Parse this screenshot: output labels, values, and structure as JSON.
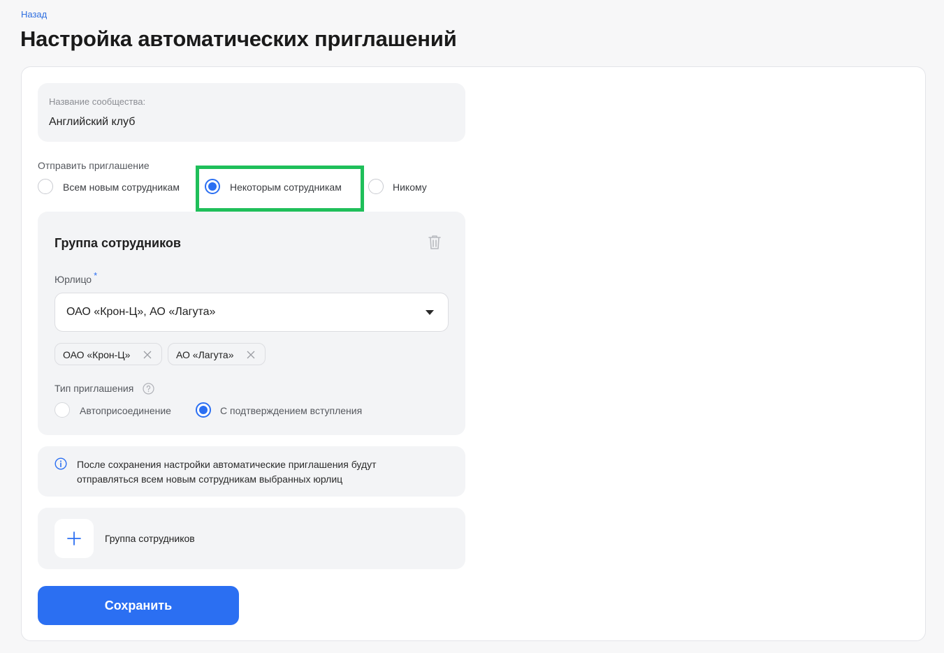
{
  "header": {
    "back_label": "Назад",
    "title": "Настройка автоматических приглашений"
  },
  "community": {
    "label": "Название сообщества:",
    "value": "Английский клуб"
  },
  "send_invite": {
    "label": "Отправить приглашение",
    "options": [
      {
        "label": "Всем новым сотрудникам",
        "checked": false
      },
      {
        "label": "Некоторым сотрудникам",
        "checked": true
      },
      {
        "label": "Никому",
        "checked": false
      }
    ]
  },
  "group": {
    "title": "Группа сотрудников",
    "legal_entity_label": "Юрлицо",
    "required_mark": "*",
    "select_value": "ОАО «Крон-Ц», АО «Лагута»",
    "chips": [
      "ОАО «Крон-Ц»",
      "АО «Лагута»"
    ],
    "invite_type_label": "Тип приглашения",
    "invite_type_options": [
      {
        "label": "Автоприсоединение",
        "checked": false
      },
      {
        "label": "С подтверждением вступления",
        "checked": true
      }
    ]
  },
  "info": {
    "text": "После сохранения настройки автоматические приглашения будут отправляться всем новым сотрудникам выбранных юрлиц"
  },
  "add_group": {
    "label": "Группа сотрудников"
  },
  "actions": {
    "save_label": "Сохранить"
  },
  "colors": {
    "accent": "#2b6ff2",
    "highlight": "#1fbf5a"
  }
}
